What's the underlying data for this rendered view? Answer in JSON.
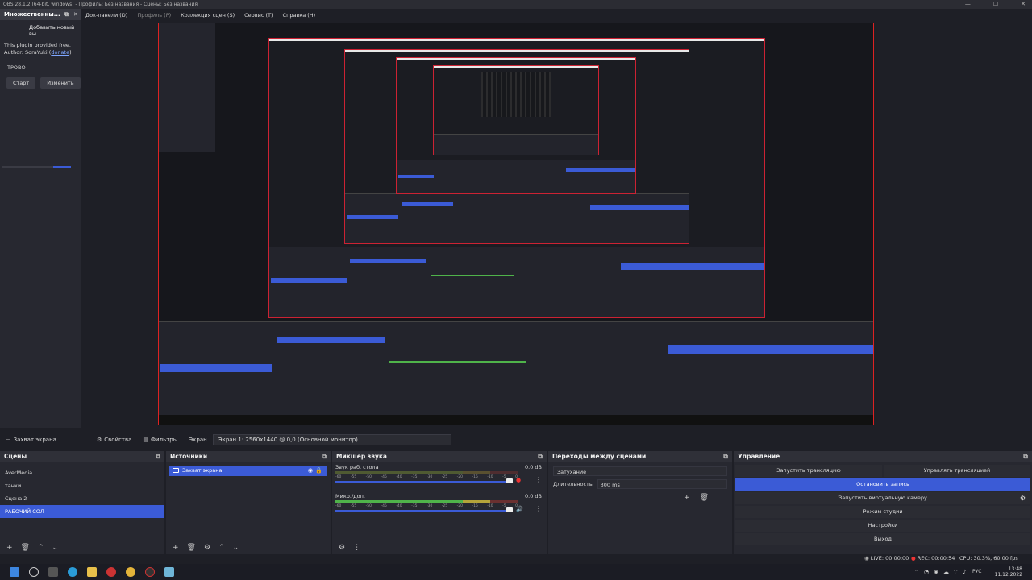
{
  "window": {
    "title": "OBS 28.1.2 (64-bit, windows) - Профиль: Без названия - Сцены: Без названия",
    "minimize": "—",
    "maximize": "☐",
    "close": "✕"
  },
  "menu": {
    "items": [
      {
        "label": "Док-панели (D)",
        "dim": false
      },
      {
        "label": "Профиль (P)",
        "dim": true
      },
      {
        "label": "Коллекция сцен (S)",
        "dim": false
      },
      {
        "label": "Сервис (T)",
        "dim": false
      },
      {
        "label": "Справка (H)",
        "dim": false
      }
    ]
  },
  "plugin_dock": {
    "title": "Множественны...",
    "add_button": "Добавить новый вы",
    "line1": "This plugin provided free.",
    "line2_prefix": "Author: SoraYuki (",
    "link": "donate",
    "line2_suffix": ")",
    "target_name": "ТРОВО",
    "start_button": "Старт",
    "edit_button": "Изменить"
  },
  "source_toolbar": {
    "source_name": "Захват экрана",
    "properties": "Свойства",
    "filters": "Фильтры",
    "screen_label": "Экран",
    "screen_value": "Экран 1: 2560x1440 @ 0,0 (Основной монитор)"
  },
  "scenes": {
    "title": "Сцены",
    "items": [
      "AverMedia",
      "танки",
      "Сцена 2",
      "РАБОЧИЙ СОЛ"
    ],
    "selected": "РАБОЧИЙ СОЛ"
  },
  "sources": {
    "title": "Источники",
    "items": [
      "Захват экрана"
    ]
  },
  "mixer": {
    "title": "Микшер звука",
    "channels": [
      {
        "name": "Звук раб. стола",
        "db": "0.0 dB"
      },
      {
        "name": "Микр./доп.",
        "db": "0.0 dB"
      }
    ],
    "ticks": [
      "-60",
      "-55",
      "-50",
      "-45",
      "-40",
      "-35",
      "-30",
      "-25",
      "-20",
      "-15",
      "-10",
      "-5",
      "0"
    ]
  },
  "transitions": {
    "title": "Переходы между сценами",
    "type": "Затухание",
    "duration_label": "Длительность",
    "duration_value": "300 ms"
  },
  "controls": {
    "title": "Управление",
    "start_stream": "Запустить трансляцию",
    "manage_stream": "Управлять трансляцией",
    "stop_record": "Остановить запись",
    "virtual_cam": "Запустить виртуальную камеру",
    "studio_mode": "Режим студии",
    "settings": "Настройки",
    "exit": "Выход"
  },
  "status": {
    "live": "LIVE: 00:00:00",
    "rec": "REC: 00:00:54",
    "cpu": "CPU: 30.3%, 60.00 fps"
  },
  "taskbar": {
    "lang": "РУС",
    "time": "13:48",
    "date": "11.12.2022"
  }
}
